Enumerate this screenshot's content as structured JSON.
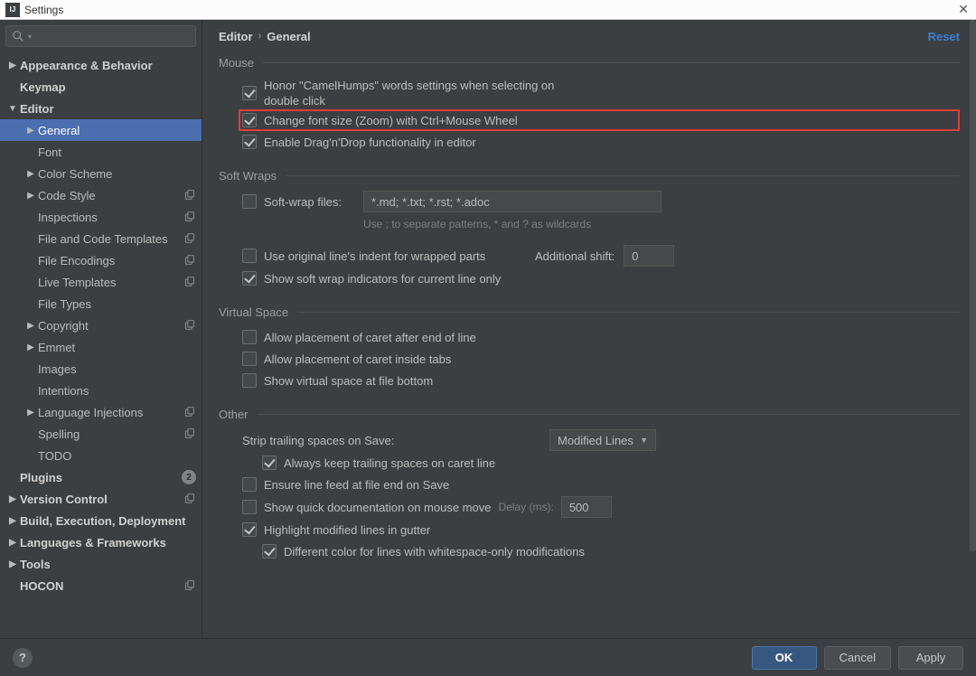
{
  "window": {
    "title": "Settings"
  },
  "search": {
    "placeholder": ""
  },
  "breadcrumb": {
    "root": "Editor",
    "current": "General",
    "reset": "Reset"
  },
  "sidebar": {
    "items": [
      {
        "label": "Appearance & Behavior",
        "depth": 0,
        "arrow": "right"
      },
      {
        "label": "Keymap",
        "depth": 0,
        "arrow": "none"
      },
      {
        "label": "Editor",
        "depth": 0,
        "arrow": "down"
      },
      {
        "label": "General",
        "depth": 1,
        "arrow": "right",
        "selected": true
      },
      {
        "label": "Font",
        "depth": 1,
        "arrow": "none"
      },
      {
        "label": "Color Scheme",
        "depth": 1,
        "arrow": "right"
      },
      {
        "label": "Code Style",
        "depth": 1,
        "arrow": "right",
        "copy": true
      },
      {
        "label": "Inspections",
        "depth": 1,
        "arrow": "none",
        "copy": true
      },
      {
        "label": "File and Code Templates",
        "depth": 1,
        "arrow": "none",
        "copy": true
      },
      {
        "label": "File Encodings",
        "depth": 1,
        "arrow": "none",
        "copy": true
      },
      {
        "label": "Live Templates",
        "depth": 1,
        "arrow": "none",
        "copy": true
      },
      {
        "label": "File Types",
        "depth": 1,
        "arrow": "none"
      },
      {
        "label": "Copyright",
        "depth": 1,
        "arrow": "right",
        "copy": true
      },
      {
        "label": "Emmet",
        "depth": 1,
        "arrow": "right"
      },
      {
        "label": "Images",
        "depth": 1,
        "arrow": "none"
      },
      {
        "label": "Intentions",
        "depth": 1,
        "arrow": "none"
      },
      {
        "label": "Language Injections",
        "depth": 1,
        "arrow": "right",
        "copy": true
      },
      {
        "label": "Spelling",
        "depth": 1,
        "arrow": "none",
        "copy": true
      },
      {
        "label": "TODO",
        "depth": 1,
        "arrow": "none"
      },
      {
        "label": "Plugins",
        "depth": 0,
        "arrow": "none",
        "count": "2"
      },
      {
        "label": "Version Control",
        "depth": 0,
        "arrow": "right",
        "copy": true
      },
      {
        "label": "Build, Execution, Deployment",
        "depth": 0,
        "arrow": "right"
      },
      {
        "label": "Languages & Frameworks",
        "depth": 0,
        "arrow": "right"
      },
      {
        "label": "Tools",
        "depth": 0,
        "arrow": "right"
      },
      {
        "label": "HOCON",
        "depth": 0,
        "arrow": "none",
        "copy": true
      }
    ]
  },
  "sections": {
    "mouse": {
      "title": "Mouse"
    },
    "softwraps": {
      "title": "Soft Wraps"
    },
    "virtual": {
      "title": "Virtual Space"
    },
    "other": {
      "title": "Other"
    }
  },
  "options": {
    "honor_camelhumps": {
      "checked": true,
      "label": "Honor \"CamelHumps\" words settings when selecting on double click"
    },
    "change_font_size": {
      "checked": true,
      "label": "Change font size (Zoom) with Ctrl+Mouse Wheel"
    },
    "enable_dnd": {
      "checked": true,
      "label": "Enable Drag'n'Drop functionality in editor"
    },
    "softwrap_files": {
      "checked": false,
      "label": "Soft-wrap files:",
      "value": "*.md; *.txt; *.rst; *.adoc",
      "hint": "Use ; to separate patterns, * and ? as wildcards"
    },
    "use_original_indent": {
      "checked": false,
      "label": "Use original line's indent for wrapped parts",
      "extra_label": "Additional shift:",
      "extra_value": "0"
    },
    "show_softwrap_indicators": {
      "checked": true,
      "label": "Show soft wrap indicators for current line only"
    },
    "caret_eol": {
      "checked": false,
      "label": "Allow placement of caret after end of line"
    },
    "caret_tabs": {
      "checked": false,
      "label": "Allow placement of caret inside tabs"
    },
    "virtual_bottom": {
      "checked": false,
      "label": "Show virtual space at file bottom"
    },
    "strip_trailing": {
      "label": "Strip trailing spaces on Save:",
      "value": "Modified Lines"
    },
    "keep_trailing_caret": {
      "checked": true,
      "label": "Always keep trailing spaces on caret line"
    },
    "ensure_lf": {
      "checked": false,
      "label": "Ensure line feed at file end on Save"
    },
    "quick_doc": {
      "checked": false,
      "label": "Show quick documentation on mouse move",
      "extra_label": "Delay (ms):",
      "extra_value": "500"
    },
    "highlight_modified": {
      "checked": true,
      "label": "Highlight modified lines in gutter"
    },
    "diff_whitespace": {
      "checked": true,
      "label": "Different color for lines with whitespace-only modifications"
    }
  },
  "buttons": {
    "help": "?",
    "ok": "OK",
    "cancel": "Cancel",
    "apply": "Apply"
  }
}
